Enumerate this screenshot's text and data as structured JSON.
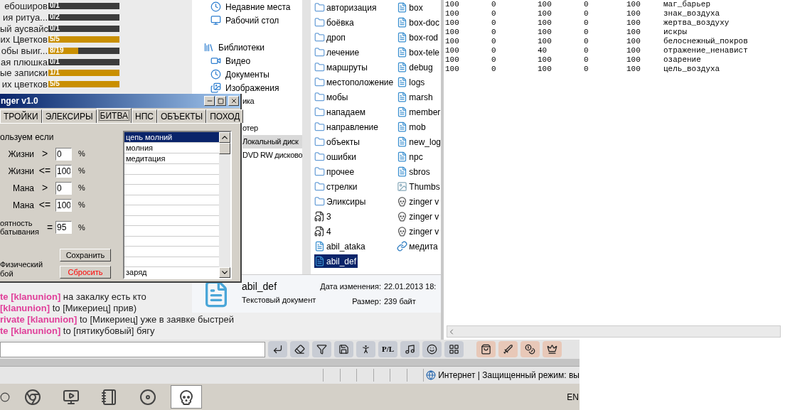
{
  "quests": [
    {
      "label": "ебоширов",
      "progress": "0/1",
      "level": 0
    },
    {
      "label": "ия ритуа...",
      "progress": "0/2",
      "level": 0
    },
    {
      "label": "ый аусвайс",
      "progress": "0/1",
      "level": 0
    },
    {
      "label": "их Цветков",
      "progress": "5/5",
      "level": 1
    },
    {
      "label": "обы выиг...",
      "progress": "8/19",
      "level": 0.42
    },
    {
      "label": "ая плюшка",
      "progress": "0/1",
      "level": 0
    },
    {
      "label": "ые записки",
      "progress": "1/1",
      "level": 1
    },
    {
      "label": "их цветков",
      "progress": "5/5",
      "level": 1
    }
  ],
  "explorer": {
    "nav_groups": [
      [
        {
          "label": "Недавние места",
          "kind": "place",
          "selected": false
        },
        {
          "label": "Рабочий стол",
          "kind": "desktop",
          "selected": false
        }
      ],
      [
        {
          "label": "Библиотеки",
          "kind": "library",
          "selected": false
        },
        {
          "label": "Видео",
          "kind": "video",
          "selected": false
        },
        {
          "label": "Документы",
          "kind": "place",
          "selected": false
        },
        {
          "label": "Изображения",
          "kind": "pictures",
          "selected": false
        },
        {
          "label": "ика",
          "kind": "partial",
          "selected": false
        }
      ],
      [
        {
          "label": "отер",
          "kind": "partial",
          "selected": false
        },
        {
          "label": "Локальный диск",
          "kind": "partial",
          "selected": true
        },
        {
          "label": "DVD RW дисково",
          "kind": "partial",
          "selected": false
        }
      ]
    ],
    "file_columns": [
      [
        {
          "name": "авторизация",
          "kind": "folder",
          "selected": false
        },
        {
          "name": "боёвка",
          "kind": "folder",
          "selected": false
        },
        {
          "name": "дроп",
          "kind": "folder",
          "selected": false
        },
        {
          "name": "лечение",
          "kind": "folder",
          "selected": false
        },
        {
          "name": "маршруты",
          "kind": "folder",
          "selected": false
        },
        {
          "name": "местоположение",
          "kind": "folder",
          "selected": false
        },
        {
          "name": "мобы",
          "kind": "folder",
          "selected": false
        },
        {
          "name": "нападаем",
          "kind": "folder",
          "selected": false
        },
        {
          "name": "направление",
          "kind": "folder",
          "selected": false
        },
        {
          "name": "объекты",
          "kind": "folder",
          "selected": false
        },
        {
          "name": "ошибки",
          "kind": "folder",
          "selected": false
        },
        {
          "name": "прочее",
          "kind": "folder",
          "selected": false
        },
        {
          "name": "стрелки",
          "kind": "folder",
          "selected": false
        },
        {
          "name": "Эликсиры",
          "kind": "folder",
          "selected": false
        },
        {
          "name": "3",
          "kind": "audio",
          "selected": false
        },
        {
          "name": "4",
          "kind": "audio",
          "selected": false
        },
        {
          "name": "abil_ataka",
          "kind": "text",
          "selected": false
        },
        {
          "name": "abil_def",
          "kind": "text",
          "selected": true
        }
      ],
      [
        {
          "name": "box",
          "kind": "text",
          "selected": false
        },
        {
          "name": "box-doc",
          "kind": "text",
          "selected": false
        },
        {
          "name": "box-rod",
          "kind": "text",
          "selected": false
        },
        {
          "name": "box-tele",
          "kind": "text",
          "selected": false
        },
        {
          "name": "debug",
          "kind": "text",
          "selected": false
        },
        {
          "name": "logs",
          "kind": "text",
          "selected": false
        },
        {
          "name": "marsh",
          "kind": "text",
          "selected": false
        },
        {
          "name": "member",
          "kind": "text",
          "selected": false
        },
        {
          "name": "mob",
          "kind": "text",
          "selected": false
        },
        {
          "name": "new_log",
          "kind": "text",
          "selected": false
        },
        {
          "name": "npc",
          "kind": "text",
          "selected": false
        },
        {
          "name": "sbros",
          "kind": "text",
          "selected": false
        },
        {
          "name": "Thumbs",
          "kind": "thumbs",
          "selected": false
        },
        {
          "name": "zinger v",
          "kind": "app",
          "selected": false
        },
        {
          "name": "zinger v",
          "kind": "app",
          "selected": false
        },
        {
          "name": "zinger v",
          "kind": "app",
          "selected": false
        },
        {
          "name": "медита",
          "kind": "shortcut",
          "selected": false
        }
      ]
    ],
    "details": {
      "name": "abil_def",
      "type": "Текстовый документ",
      "modified_label": "Дата изменения:",
      "modified": "22.01.2013 18:",
      "size_label": "Размер:",
      "size": "239 байт"
    }
  },
  "notepad": {
    "rows": [
      [
        "100",
        "0",
        "100",
        "0",
        "100",
        "маг_барьер"
      ],
      [
        "100",
        "0",
        "100",
        "0",
        "100",
        "знак_воздуха"
      ],
      [
        "100",
        "0",
        "100",
        "0",
        "100",
        "жертва_воздуху"
      ],
      [
        "100",
        "0",
        "100",
        "0",
        "100",
        "искры"
      ],
      [
        "100",
        "0",
        "100",
        "0",
        "100",
        "белоснежный_покров"
      ],
      [
        "100",
        "0",
        "40",
        "0",
        "100",
        "отражение_ненавист"
      ],
      [
        "100",
        "0",
        "100",
        "0",
        "100",
        "озарение"
      ],
      [
        "100",
        "0",
        "100",
        "0",
        "100",
        "цель_воздуха"
      ]
    ]
  },
  "dialog": {
    "title": "nger v1.0",
    "tabs": [
      {
        "label": "ТРОЙКИ",
        "selected": false
      },
      {
        "label": "ЭЛЕКСИРЫ",
        "selected": false
      },
      {
        "label": "БИТВА",
        "selected": true
      },
      {
        "label": "НПС",
        "selected": false
      },
      {
        "label": "ОБЪЕКТЫ",
        "selected": false
      },
      {
        "label": "ПОХОД",
        "selected": false
      }
    ],
    "section_label": "ользуем если",
    "conditions": [
      {
        "label": "Жизни",
        "op": ">",
        "value": "0",
        "unit": "%"
      },
      {
        "label": "Жизни",
        "op": "<=",
        "value": "100",
        "unit": "%"
      },
      {
        "label": "Мана",
        "op": ">",
        "value": "0",
        "unit": "%"
      },
      {
        "label": "Мана",
        "op": "<=",
        "value": "100",
        "unit": "%"
      }
    ],
    "chance": {
      "label_lines": [
        "оятность",
        "батывания"
      ],
      "op": "=",
      "value": "95",
      "unit": "%"
    },
    "physical_lines": [
      "Физический",
      "бой"
    ],
    "buttons": [
      {
        "label": "Сохранить",
        "kind": "normal"
      },
      {
        "label": "Сбросить",
        "kind": "danger"
      }
    ],
    "skills": [
      {
        "label": "цепь молний",
        "selected": true
      },
      {
        "label": "молния",
        "selected": false
      },
      {
        "label": "медитация",
        "selected": false
      }
    ],
    "bottom_skill": {
      "label": "заряд",
      "selected": false
    }
  },
  "chat": [
    {
      "prefix": "te [klanunion]",
      "text": "на закалку есть кто"
    },
    {
      "prefix": "[klanunion]",
      "text": "to [Микериец] прив)"
    },
    {
      "prefix": "rivate [klanunion]",
      "text": "to [Микериец] уже в заявке быстрей"
    },
    {
      "prefix": "te [klanunion]",
      "text": "to [пятикубовый] бягу"
    }
  ],
  "toolbar": [
    {
      "kind": "enter"
    },
    {
      "kind": "eraser"
    },
    {
      "kind": "filter"
    },
    {
      "kind": "save"
    },
    {
      "kind": "figure"
    },
    {
      "kind": "glyph",
      "label": "P/L"
    },
    {
      "kind": "music"
    },
    {
      "kind": "smile"
    },
    {
      "kind": "grid"
    },
    {
      "kind": "bag"
    },
    {
      "kind": "sword"
    },
    {
      "kind": "money"
    },
    {
      "kind": "crown"
    }
  ],
  "status_bar": {
    "zone": "Интернет | Защищенный режим: вы"
  },
  "taskbar": {
    "apps": [
      {
        "kind": "ball",
        "selected": false
      },
      {
        "kind": "browser",
        "selected": false
      },
      {
        "kind": "remote",
        "selected": false
      },
      {
        "kind": "notes",
        "selected": false
      },
      {
        "kind": "disk",
        "selected": false
      },
      {
        "kind": "skull",
        "selected": true
      }
    ],
    "language": "EN"
  }
}
